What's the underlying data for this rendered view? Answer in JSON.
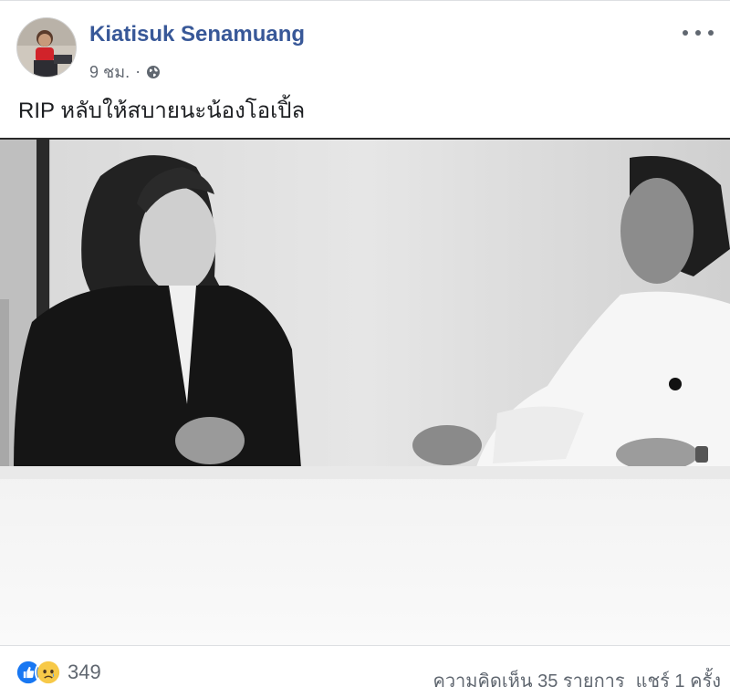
{
  "post": {
    "author": "Kiatisuk Senamuang",
    "time": "9 ชม.",
    "separator": "·",
    "privacy_icon": "globe-icon",
    "more_icon": "more-options-icon",
    "text": "RIP หลับให้สบายนะน้องโอเปิ้ล"
  },
  "footer": {
    "reactions": [
      "like-icon",
      "sad-icon"
    ],
    "reaction_count": "349",
    "comments": "ความคิดเห็น 35 รายการ",
    "shares": "แชร์ 1 ครั้ง"
  },
  "colors": {
    "author_name": "#385898",
    "meta_text": "#616770",
    "like_blue": "#1877f2",
    "sad_yellow": "#f7c948"
  }
}
